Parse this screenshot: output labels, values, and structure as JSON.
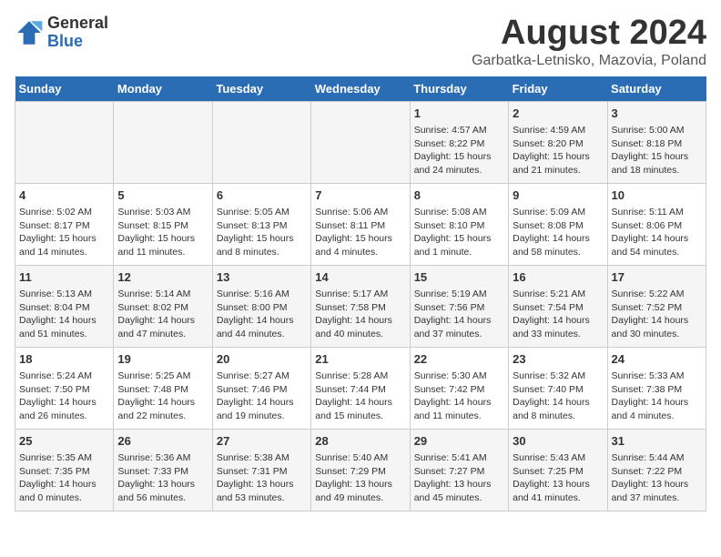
{
  "header": {
    "logo_general": "General",
    "logo_blue": "Blue",
    "title": "August 2024",
    "subtitle": "Garbatka-Letnisko, Mazovia, Poland"
  },
  "days_of_week": [
    "Sunday",
    "Monday",
    "Tuesday",
    "Wednesday",
    "Thursday",
    "Friday",
    "Saturday"
  ],
  "weeks": [
    [
      {
        "day": "",
        "info": ""
      },
      {
        "day": "",
        "info": ""
      },
      {
        "day": "",
        "info": ""
      },
      {
        "day": "",
        "info": ""
      },
      {
        "day": "1",
        "info": "Sunrise: 4:57 AM\nSunset: 8:22 PM\nDaylight: 15 hours\nand 24 minutes."
      },
      {
        "day": "2",
        "info": "Sunrise: 4:59 AM\nSunset: 8:20 PM\nDaylight: 15 hours\nand 21 minutes."
      },
      {
        "day": "3",
        "info": "Sunrise: 5:00 AM\nSunset: 8:18 PM\nDaylight: 15 hours\nand 18 minutes."
      }
    ],
    [
      {
        "day": "4",
        "info": "Sunrise: 5:02 AM\nSunset: 8:17 PM\nDaylight: 15 hours\nand 14 minutes."
      },
      {
        "day": "5",
        "info": "Sunrise: 5:03 AM\nSunset: 8:15 PM\nDaylight: 15 hours\nand 11 minutes."
      },
      {
        "day": "6",
        "info": "Sunrise: 5:05 AM\nSunset: 8:13 PM\nDaylight: 15 hours\nand 8 minutes."
      },
      {
        "day": "7",
        "info": "Sunrise: 5:06 AM\nSunset: 8:11 PM\nDaylight: 15 hours\nand 4 minutes."
      },
      {
        "day": "8",
        "info": "Sunrise: 5:08 AM\nSunset: 8:10 PM\nDaylight: 15 hours\nand 1 minute."
      },
      {
        "day": "9",
        "info": "Sunrise: 5:09 AM\nSunset: 8:08 PM\nDaylight: 14 hours\nand 58 minutes."
      },
      {
        "day": "10",
        "info": "Sunrise: 5:11 AM\nSunset: 8:06 PM\nDaylight: 14 hours\nand 54 minutes."
      }
    ],
    [
      {
        "day": "11",
        "info": "Sunrise: 5:13 AM\nSunset: 8:04 PM\nDaylight: 14 hours\nand 51 minutes."
      },
      {
        "day": "12",
        "info": "Sunrise: 5:14 AM\nSunset: 8:02 PM\nDaylight: 14 hours\nand 47 minutes."
      },
      {
        "day": "13",
        "info": "Sunrise: 5:16 AM\nSunset: 8:00 PM\nDaylight: 14 hours\nand 44 minutes."
      },
      {
        "day": "14",
        "info": "Sunrise: 5:17 AM\nSunset: 7:58 PM\nDaylight: 14 hours\nand 40 minutes."
      },
      {
        "day": "15",
        "info": "Sunrise: 5:19 AM\nSunset: 7:56 PM\nDaylight: 14 hours\nand 37 minutes."
      },
      {
        "day": "16",
        "info": "Sunrise: 5:21 AM\nSunset: 7:54 PM\nDaylight: 14 hours\nand 33 minutes."
      },
      {
        "day": "17",
        "info": "Sunrise: 5:22 AM\nSunset: 7:52 PM\nDaylight: 14 hours\nand 30 minutes."
      }
    ],
    [
      {
        "day": "18",
        "info": "Sunrise: 5:24 AM\nSunset: 7:50 PM\nDaylight: 14 hours\nand 26 minutes."
      },
      {
        "day": "19",
        "info": "Sunrise: 5:25 AM\nSunset: 7:48 PM\nDaylight: 14 hours\nand 22 minutes."
      },
      {
        "day": "20",
        "info": "Sunrise: 5:27 AM\nSunset: 7:46 PM\nDaylight: 14 hours\nand 19 minutes."
      },
      {
        "day": "21",
        "info": "Sunrise: 5:28 AM\nSunset: 7:44 PM\nDaylight: 14 hours\nand 15 minutes."
      },
      {
        "day": "22",
        "info": "Sunrise: 5:30 AM\nSunset: 7:42 PM\nDaylight: 14 hours\nand 11 minutes."
      },
      {
        "day": "23",
        "info": "Sunrise: 5:32 AM\nSunset: 7:40 PM\nDaylight: 14 hours\nand 8 minutes."
      },
      {
        "day": "24",
        "info": "Sunrise: 5:33 AM\nSunset: 7:38 PM\nDaylight: 14 hours\nand 4 minutes."
      }
    ],
    [
      {
        "day": "25",
        "info": "Sunrise: 5:35 AM\nSunset: 7:35 PM\nDaylight: 14 hours\nand 0 minutes."
      },
      {
        "day": "26",
        "info": "Sunrise: 5:36 AM\nSunset: 7:33 PM\nDaylight: 13 hours\nand 56 minutes."
      },
      {
        "day": "27",
        "info": "Sunrise: 5:38 AM\nSunset: 7:31 PM\nDaylight: 13 hours\nand 53 minutes."
      },
      {
        "day": "28",
        "info": "Sunrise: 5:40 AM\nSunset: 7:29 PM\nDaylight: 13 hours\nand 49 minutes."
      },
      {
        "day": "29",
        "info": "Sunrise: 5:41 AM\nSunset: 7:27 PM\nDaylight: 13 hours\nand 45 minutes."
      },
      {
        "day": "30",
        "info": "Sunrise: 5:43 AM\nSunset: 7:25 PM\nDaylight: 13 hours\nand 41 minutes."
      },
      {
        "day": "31",
        "info": "Sunrise: 5:44 AM\nSunset: 7:22 PM\nDaylight: 13 hours\nand 37 minutes."
      }
    ]
  ]
}
